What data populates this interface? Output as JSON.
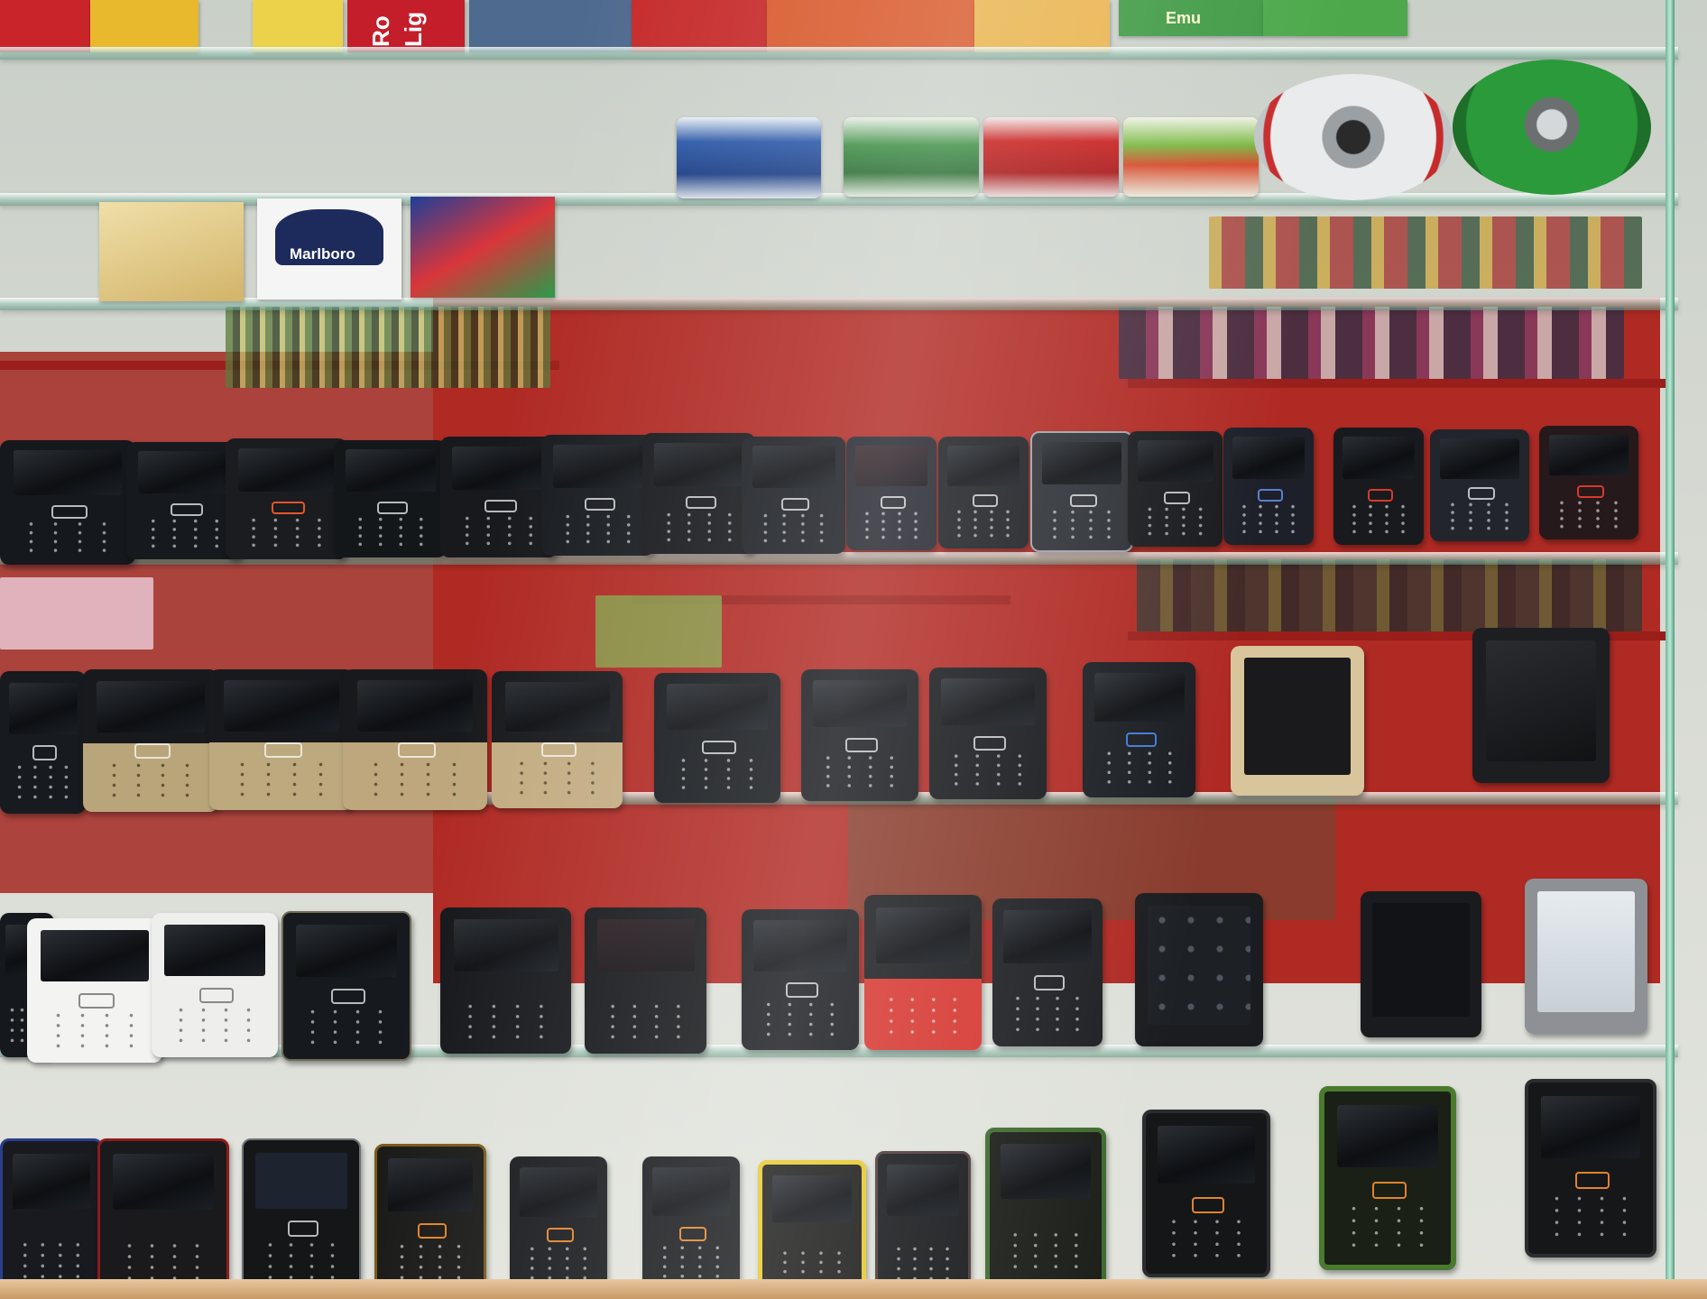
{
  "scene": {
    "labels": {
      "top_box_left": "Emu",
      "cigarette_box": "Marlboro",
      "top_box_text_a": "Ro",
      "top_box_text_b": "Lig"
    }
  }
}
